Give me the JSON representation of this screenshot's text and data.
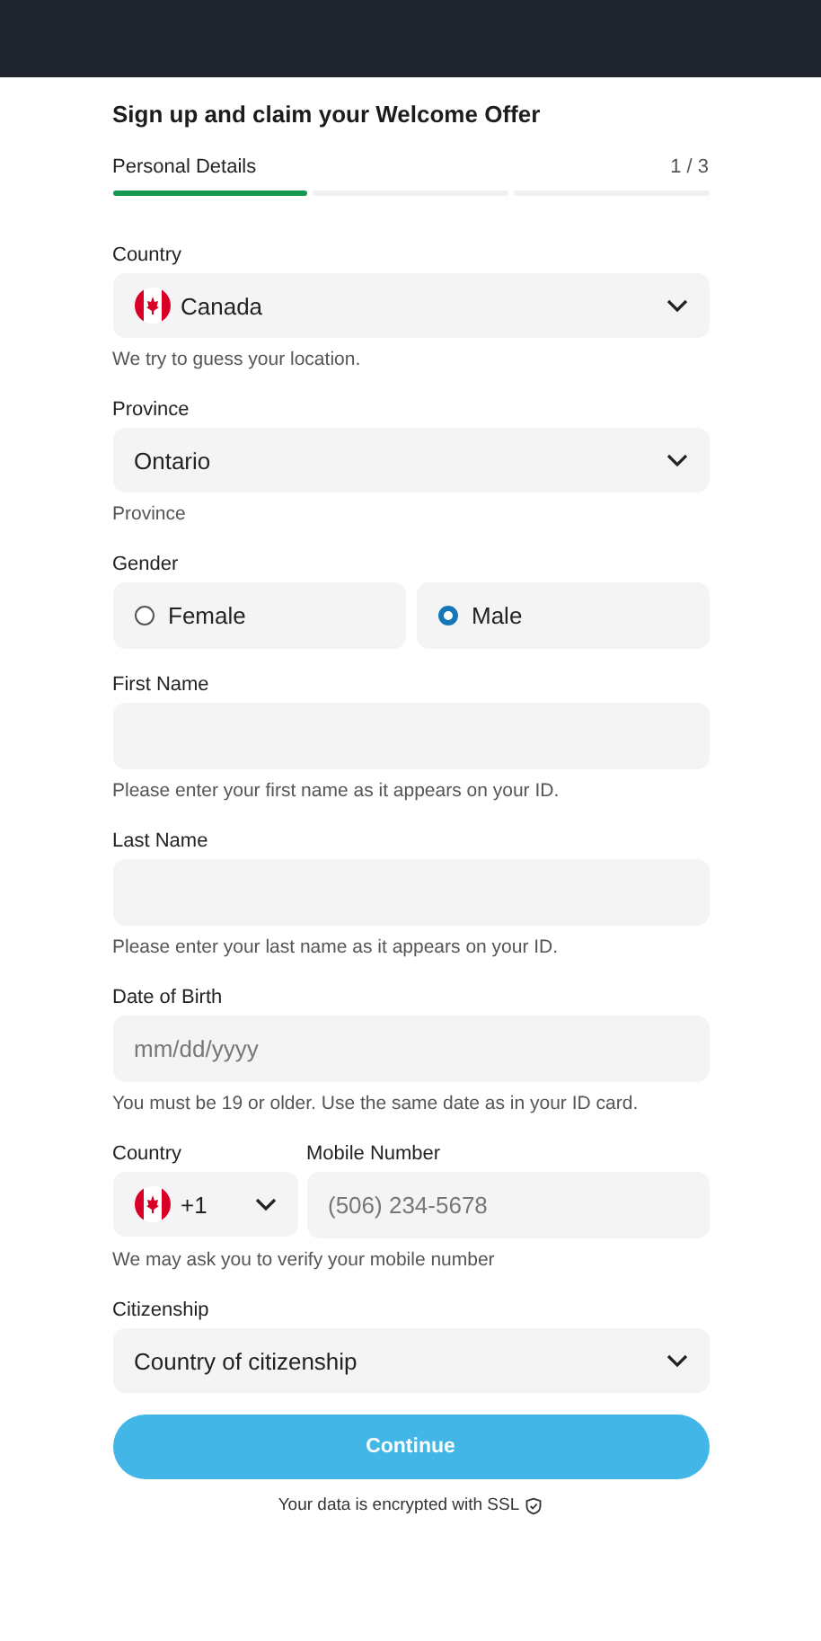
{
  "title": "Sign up and claim your Welcome Offer",
  "progress": {
    "label": "Personal Details",
    "count": "1 / 3",
    "steps": [
      {
        "complete": true
      },
      {
        "complete": false
      },
      {
        "complete": false
      }
    ]
  },
  "fields": [
    {
      "kind": "select",
      "label": "Country",
      "value": "Canada",
      "flag": true,
      "hint": "We try to guess your location."
    },
    {
      "kind": "select",
      "label": "Province",
      "value": "Ontario",
      "flag": false,
      "hint": "Province"
    },
    {
      "kind": "radio",
      "label": "Gender",
      "options": [
        {
          "label": "Female",
          "selected": false
        },
        {
          "label": "Male",
          "selected": true
        }
      ]
    },
    {
      "kind": "input",
      "label": "First Name",
      "hint": "Please enter your first name as it appears on your ID."
    },
    {
      "kind": "input",
      "label": "Last Name",
      "hint": "Please enter your last name as it appears on your ID."
    },
    {
      "kind": "input",
      "label": "Date of Birth",
      "placeholder": "mm/dd/yyyy",
      "hint": "You must be 19 or older. Use the same date as in your ID card."
    },
    {
      "kind": "phone",
      "label": "Country",
      "code": "+1",
      "number_label": "Mobile Number",
      "placeholder": "(506) 234-5678",
      "hint": "We may ask you to verify your mobile number"
    },
    {
      "kind": "select",
      "label": "Citizenship",
      "value": "Country of citizenship",
      "flag": false
    }
  ],
  "button": "Continue",
  "footer": "Your data is encrypted with SSL"
}
